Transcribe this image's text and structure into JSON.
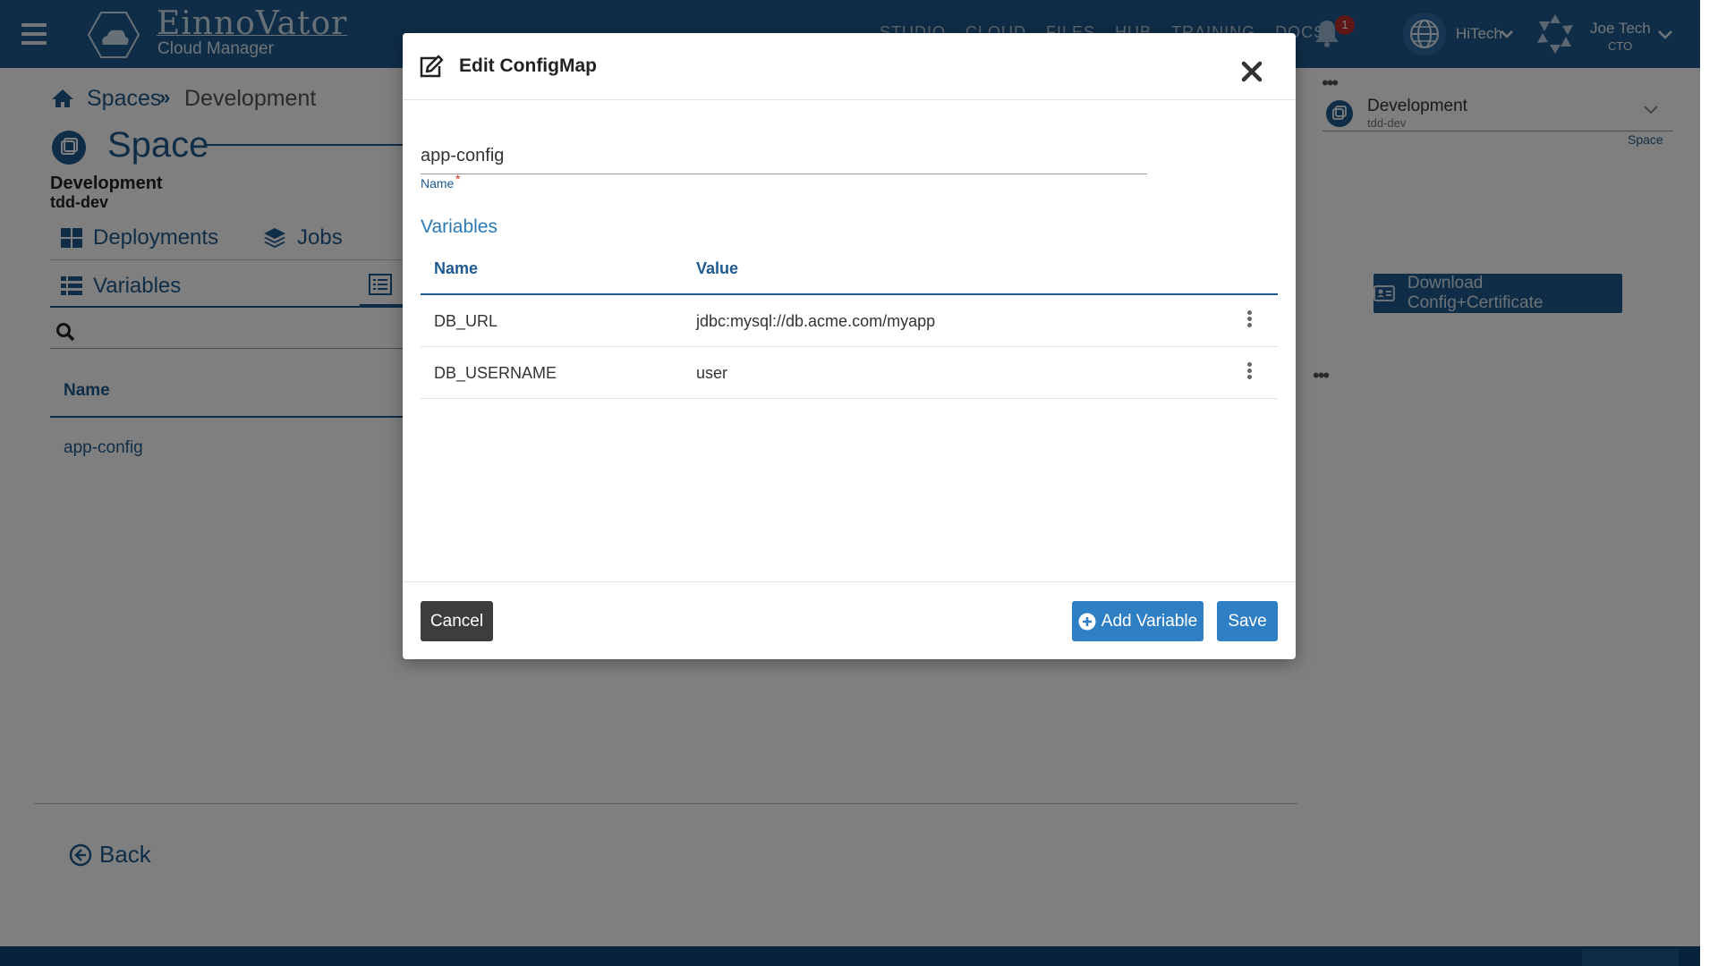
{
  "app": {
    "brand": "EinnoVator",
    "subtitle": "Cloud Manager",
    "nav": [
      "STUDIO",
      "CLOUD",
      "FILES",
      "HUB",
      "TRAINING",
      "DOCS"
    ],
    "notifications_count": "1",
    "org_name": "HiTech",
    "user_name": "Joe Tech",
    "user_role": "CTO"
  },
  "page": {
    "breadcrumb": {
      "spaces": "Spaces",
      "separator": "»",
      "current": "Development"
    },
    "title": "Space",
    "space_name": "Development",
    "space_code": "tdd-dev",
    "tabs": {
      "deployments": "Deployments",
      "jobs": "Jobs",
      "variables": "Variables"
    },
    "table_header_name": "Name",
    "rows": [
      "app-config"
    ],
    "back_label": "Back"
  },
  "context": {
    "name": "Development",
    "sub": "tdd-dev",
    "label": "Space",
    "download_label": "Download Config+Certificate"
  },
  "modal": {
    "title": "Edit ConfigMap",
    "name_value": "app-config",
    "name_label": "Name",
    "required_mark": "*",
    "variables_heading": "Variables",
    "columns": {
      "name": "Name",
      "value": "Value"
    },
    "variables": [
      {
        "name": "DB_URL",
        "value": "jdbc:mysql://db.acme.com/myapp"
      },
      {
        "name": "DB_USERNAME",
        "value": "user"
      }
    ],
    "cancel_label": "Cancel",
    "add_variable_label": "Add Variable",
    "save_label": "Save"
  },
  "colors": {
    "primary": "#1e5a8e",
    "button_blue": "#2f7fc4",
    "cancel_dark": "#3d3d3d",
    "badge_red": "#c0302f"
  }
}
